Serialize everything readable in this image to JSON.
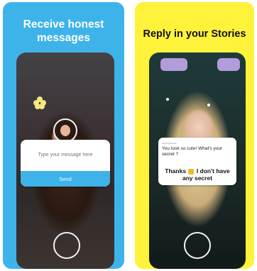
{
  "left_card": {
    "headline_line1": "Receive honest",
    "headline_line2": "messages",
    "message_placeholder": "Type your message here",
    "send_label": "Send"
  },
  "right_card": {
    "headline": "Reply in your Stories",
    "sender_label": "anonymous",
    "question": "You look so cute! What's your secret ?",
    "answer_before_emoji": "Thanks",
    "answer_after_emoji": "I don't have any secret"
  },
  "colors": {
    "left_background": "#3eb3ea",
    "right_background": "#fff23a",
    "send_button": "#3eb3ea"
  },
  "icons": {
    "shutter": "camera-shutter-icon",
    "bitmoji": "bitmoji-avatar-icon",
    "emoji": "flexed-biceps-emoji-icon"
  }
}
